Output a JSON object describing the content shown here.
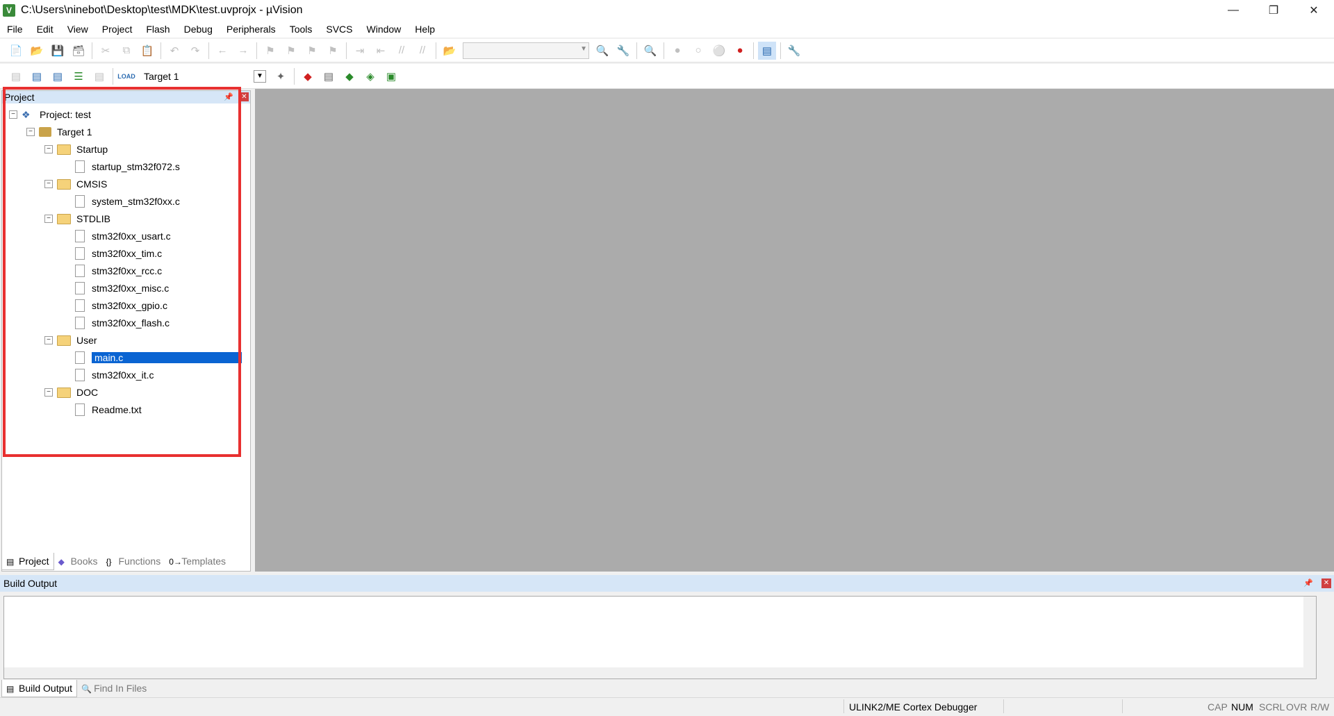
{
  "window": {
    "title": "C:\\Users\\ninebot\\Desktop\\test\\MDK\\test.uvprojx - µVision",
    "app_icon_letter": "V"
  },
  "menu": [
    "File",
    "Edit",
    "View",
    "Project",
    "Flash",
    "Debug",
    "Peripherals",
    "Tools",
    "SVCS",
    "Window",
    "Help"
  ],
  "toolbar2": {
    "target": "Target 1",
    "load_label": "LOAD"
  },
  "project_panel": {
    "title": "Project",
    "tree": [
      {
        "label": "Project: test",
        "type": "project",
        "level": 0
      },
      {
        "label": "Target 1",
        "type": "target",
        "level": 1
      },
      {
        "label": "Startup",
        "type": "folder",
        "level": 2
      },
      {
        "label": "startup_stm32f072.s",
        "type": "file",
        "level": 3
      },
      {
        "label": "CMSIS",
        "type": "folder",
        "level": 2
      },
      {
        "label": "system_stm32f0xx.c",
        "type": "file",
        "level": 3
      },
      {
        "label": "STDLIB",
        "type": "folder",
        "level": 2
      },
      {
        "label": "stm32f0xx_usart.c",
        "type": "file",
        "level": 3
      },
      {
        "label": "stm32f0xx_tim.c",
        "type": "file",
        "level": 3
      },
      {
        "label": "stm32f0xx_rcc.c",
        "type": "file",
        "level": 3
      },
      {
        "label": "stm32f0xx_misc.c",
        "type": "file",
        "level": 3
      },
      {
        "label": "stm32f0xx_gpio.c",
        "type": "file",
        "level": 3
      },
      {
        "label": "stm32f0xx_flash.c",
        "type": "file",
        "level": 3
      },
      {
        "label": "User",
        "type": "folder",
        "level": 2
      },
      {
        "label": "main.c",
        "type": "file",
        "level": 3,
        "selected": true
      },
      {
        "label": "stm32f0xx_it.c",
        "type": "file",
        "level": 3
      },
      {
        "label": "DOC",
        "type": "folder",
        "level": 2
      },
      {
        "label": "Readme.txt",
        "type": "file",
        "level": 3
      }
    ],
    "tabs": [
      "Project",
      "Books",
      "Functions",
      "Templates"
    ]
  },
  "build_output": {
    "title": "Build Output",
    "tabs": [
      "Build Output",
      "Find In Files"
    ]
  },
  "statusbar": {
    "debugger": "ULINK2/ME Cortex Debugger",
    "cap": "CAP",
    "num": "NUM",
    "scrl": "SCRL",
    "ovr": "OVR",
    "rw": "R/W"
  },
  "colors": {
    "selection": "#0a64d2",
    "highlight_box": "#e83030",
    "editor_bg": "#ababab",
    "panel_header": "#d6e6f7"
  }
}
